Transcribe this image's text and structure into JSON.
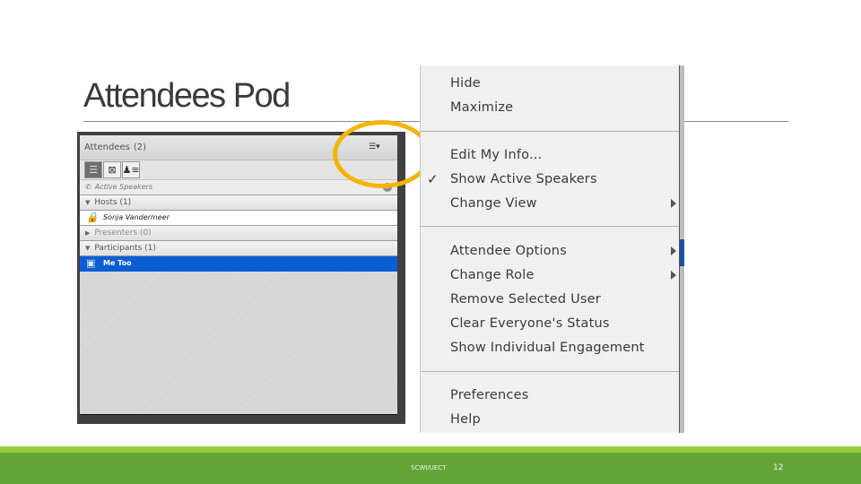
{
  "slide": {
    "title": "Attendees Pod",
    "footer_text": "SCWI/UECT",
    "page_number": "12"
  },
  "pod": {
    "title": "Attendees",
    "count": "(2)",
    "menu_icon": "pod-options-menu-icon",
    "toolbar": [
      {
        "name": "list-view",
        "icon": "list-icon",
        "active": true
      },
      {
        "name": "breakout-view",
        "icon": "breakout-icon",
        "active": false
      },
      {
        "name": "status-view",
        "icon": "attendee-status-icon",
        "active": false
      }
    ],
    "active_speakers_label": "Active Speakers",
    "groups": [
      {
        "label": "Hosts (1)",
        "expanded": true,
        "users": [
          {
            "name": "Sonja Vandermeer",
            "icon": "host-icon",
            "selected": false
          }
        ]
      },
      {
        "label": "Presenters (0)",
        "expanded": false,
        "users": []
      },
      {
        "label": "Participants (1)",
        "expanded": true,
        "users": [
          {
            "name": "Me Too",
            "icon": "participant-icon",
            "selected": true
          }
        ]
      }
    ]
  },
  "menu": {
    "items": [
      {
        "label": "Hide",
        "checked": false,
        "submenu": false
      },
      {
        "label": "Maximize",
        "checked": false,
        "submenu": false
      },
      {
        "label": "Edit My Info...",
        "checked": false,
        "submenu": false
      },
      {
        "label": "Show Active Speakers",
        "checked": true,
        "submenu": false
      },
      {
        "label": "Change View",
        "checked": false,
        "submenu": true
      },
      {
        "label": "Attendee Options",
        "checked": false,
        "submenu": true
      },
      {
        "label": "Change Role",
        "checked": false,
        "submenu": true
      },
      {
        "label": "Remove Selected User",
        "checked": false,
        "submenu": false
      },
      {
        "label": "Clear Everyone's Status",
        "checked": false,
        "submenu": false
      },
      {
        "label": "Show Individual Engagement",
        "checked": false,
        "submenu": false
      },
      {
        "label": "Preferences",
        "checked": false,
        "submenu": false
      },
      {
        "label": "Help",
        "checked": false,
        "submenu": false
      }
    ],
    "check_glyph": "✓"
  },
  "colors": {
    "highlight": "#f5b400",
    "selection": "#0b5ed1",
    "footer_green": "#63a537",
    "footer_light_green": "#99cc3d"
  }
}
